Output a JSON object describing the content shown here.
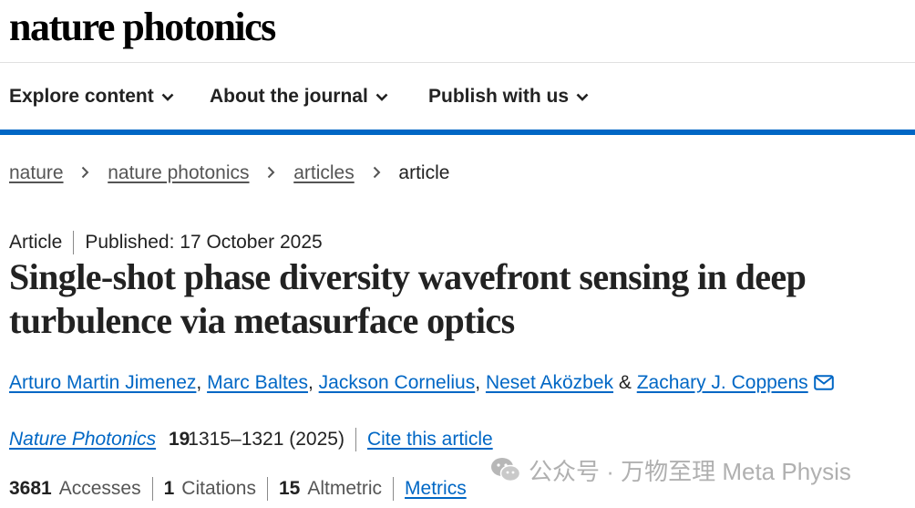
{
  "header": {
    "logo": "nature photonics"
  },
  "nav": {
    "items": [
      {
        "label": "Explore content"
      },
      {
        "label": "About the journal"
      },
      {
        "label": "Publish with us"
      }
    ]
  },
  "breadcrumb": {
    "items": [
      "nature",
      "nature photonics",
      "articles"
    ],
    "current": "article"
  },
  "article": {
    "type": "Article",
    "published": "Published: 17 October 2025",
    "title": "Single-shot phase diversity wavefront sensing in deep turbulence via metasurface optics",
    "authors": [
      "Arturo Martin Jimenez",
      "Marc Baltes",
      "Jackson Cornelius",
      "Neset Akӧzbek",
      "Zachary J. Coppens"
    ],
    "author_separator": ",",
    "author_last_separator": "&",
    "journal": "Nature Photonics",
    "volume": "19",
    "pages_year": "1315–1321 (2025)",
    "cite_label": "Cite this article"
  },
  "metrics": {
    "accesses_count": "3681",
    "accesses_label": "Accesses",
    "citations_count": "1",
    "citations_label": "Citations",
    "altmetric_count": "15",
    "altmetric_label": "Altmetric",
    "metrics_link": "Metrics"
  },
  "watermark": {
    "text": "公众号 · 万物至理 Meta Physis",
    "icon": "wechat-icon"
  },
  "colors": {
    "accent": "#0067c5",
    "text": "#222222",
    "muted": "#555555"
  }
}
